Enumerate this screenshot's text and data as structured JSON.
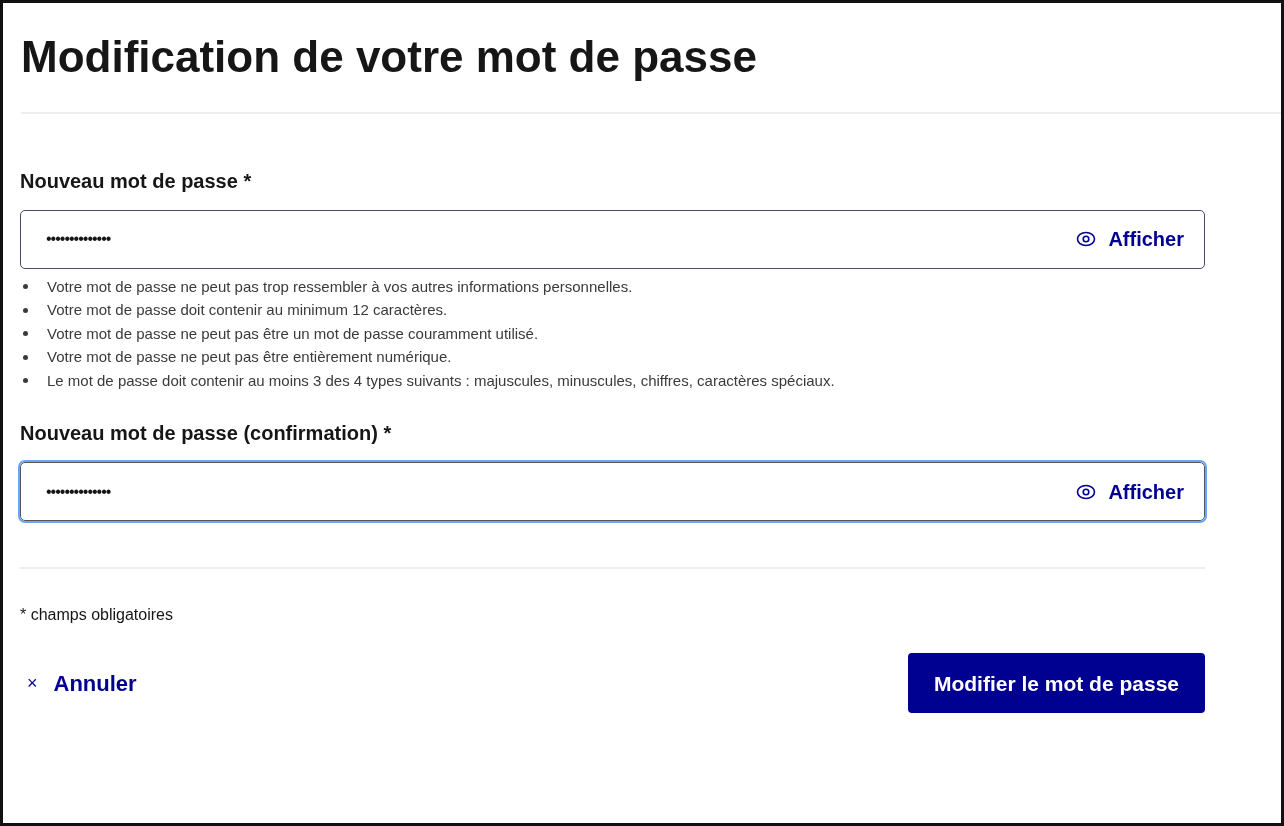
{
  "title": "Modification de votre mot de passe",
  "fields": [
    {
      "label": "Nouveau mot de passe",
      "required_mark": "*",
      "value": "••••••••••••••",
      "toggle": "Afficher",
      "focused": false,
      "hints": [
        "Votre mot de passe ne peut pas trop ressembler à vos autres informations personnelles.",
        "Votre mot de passe doit contenir au minimum 12 caractères.",
        "Votre mot de passe ne peut pas être un mot de passe couramment utilisé.",
        "Votre mot de passe ne peut pas être entièrement numérique.",
        "Le mot de passe doit contenir au moins 3 des 4 types suivants : majuscules, minuscules, chiffres, caractères spéciaux."
      ]
    },
    {
      "label": "Nouveau mot de passe (confirmation)",
      "required_mark": "*",
      "value": "••••••••••••••",
      "toggle": "Afficher",
      "focused": true
    }
  ],
  "required_note": "* champs obligatoires",
  "cancel": {
    "icon": "×",
    "label": "Annuler"
  },
  "submit": "Modifier le mot de passe"
}
